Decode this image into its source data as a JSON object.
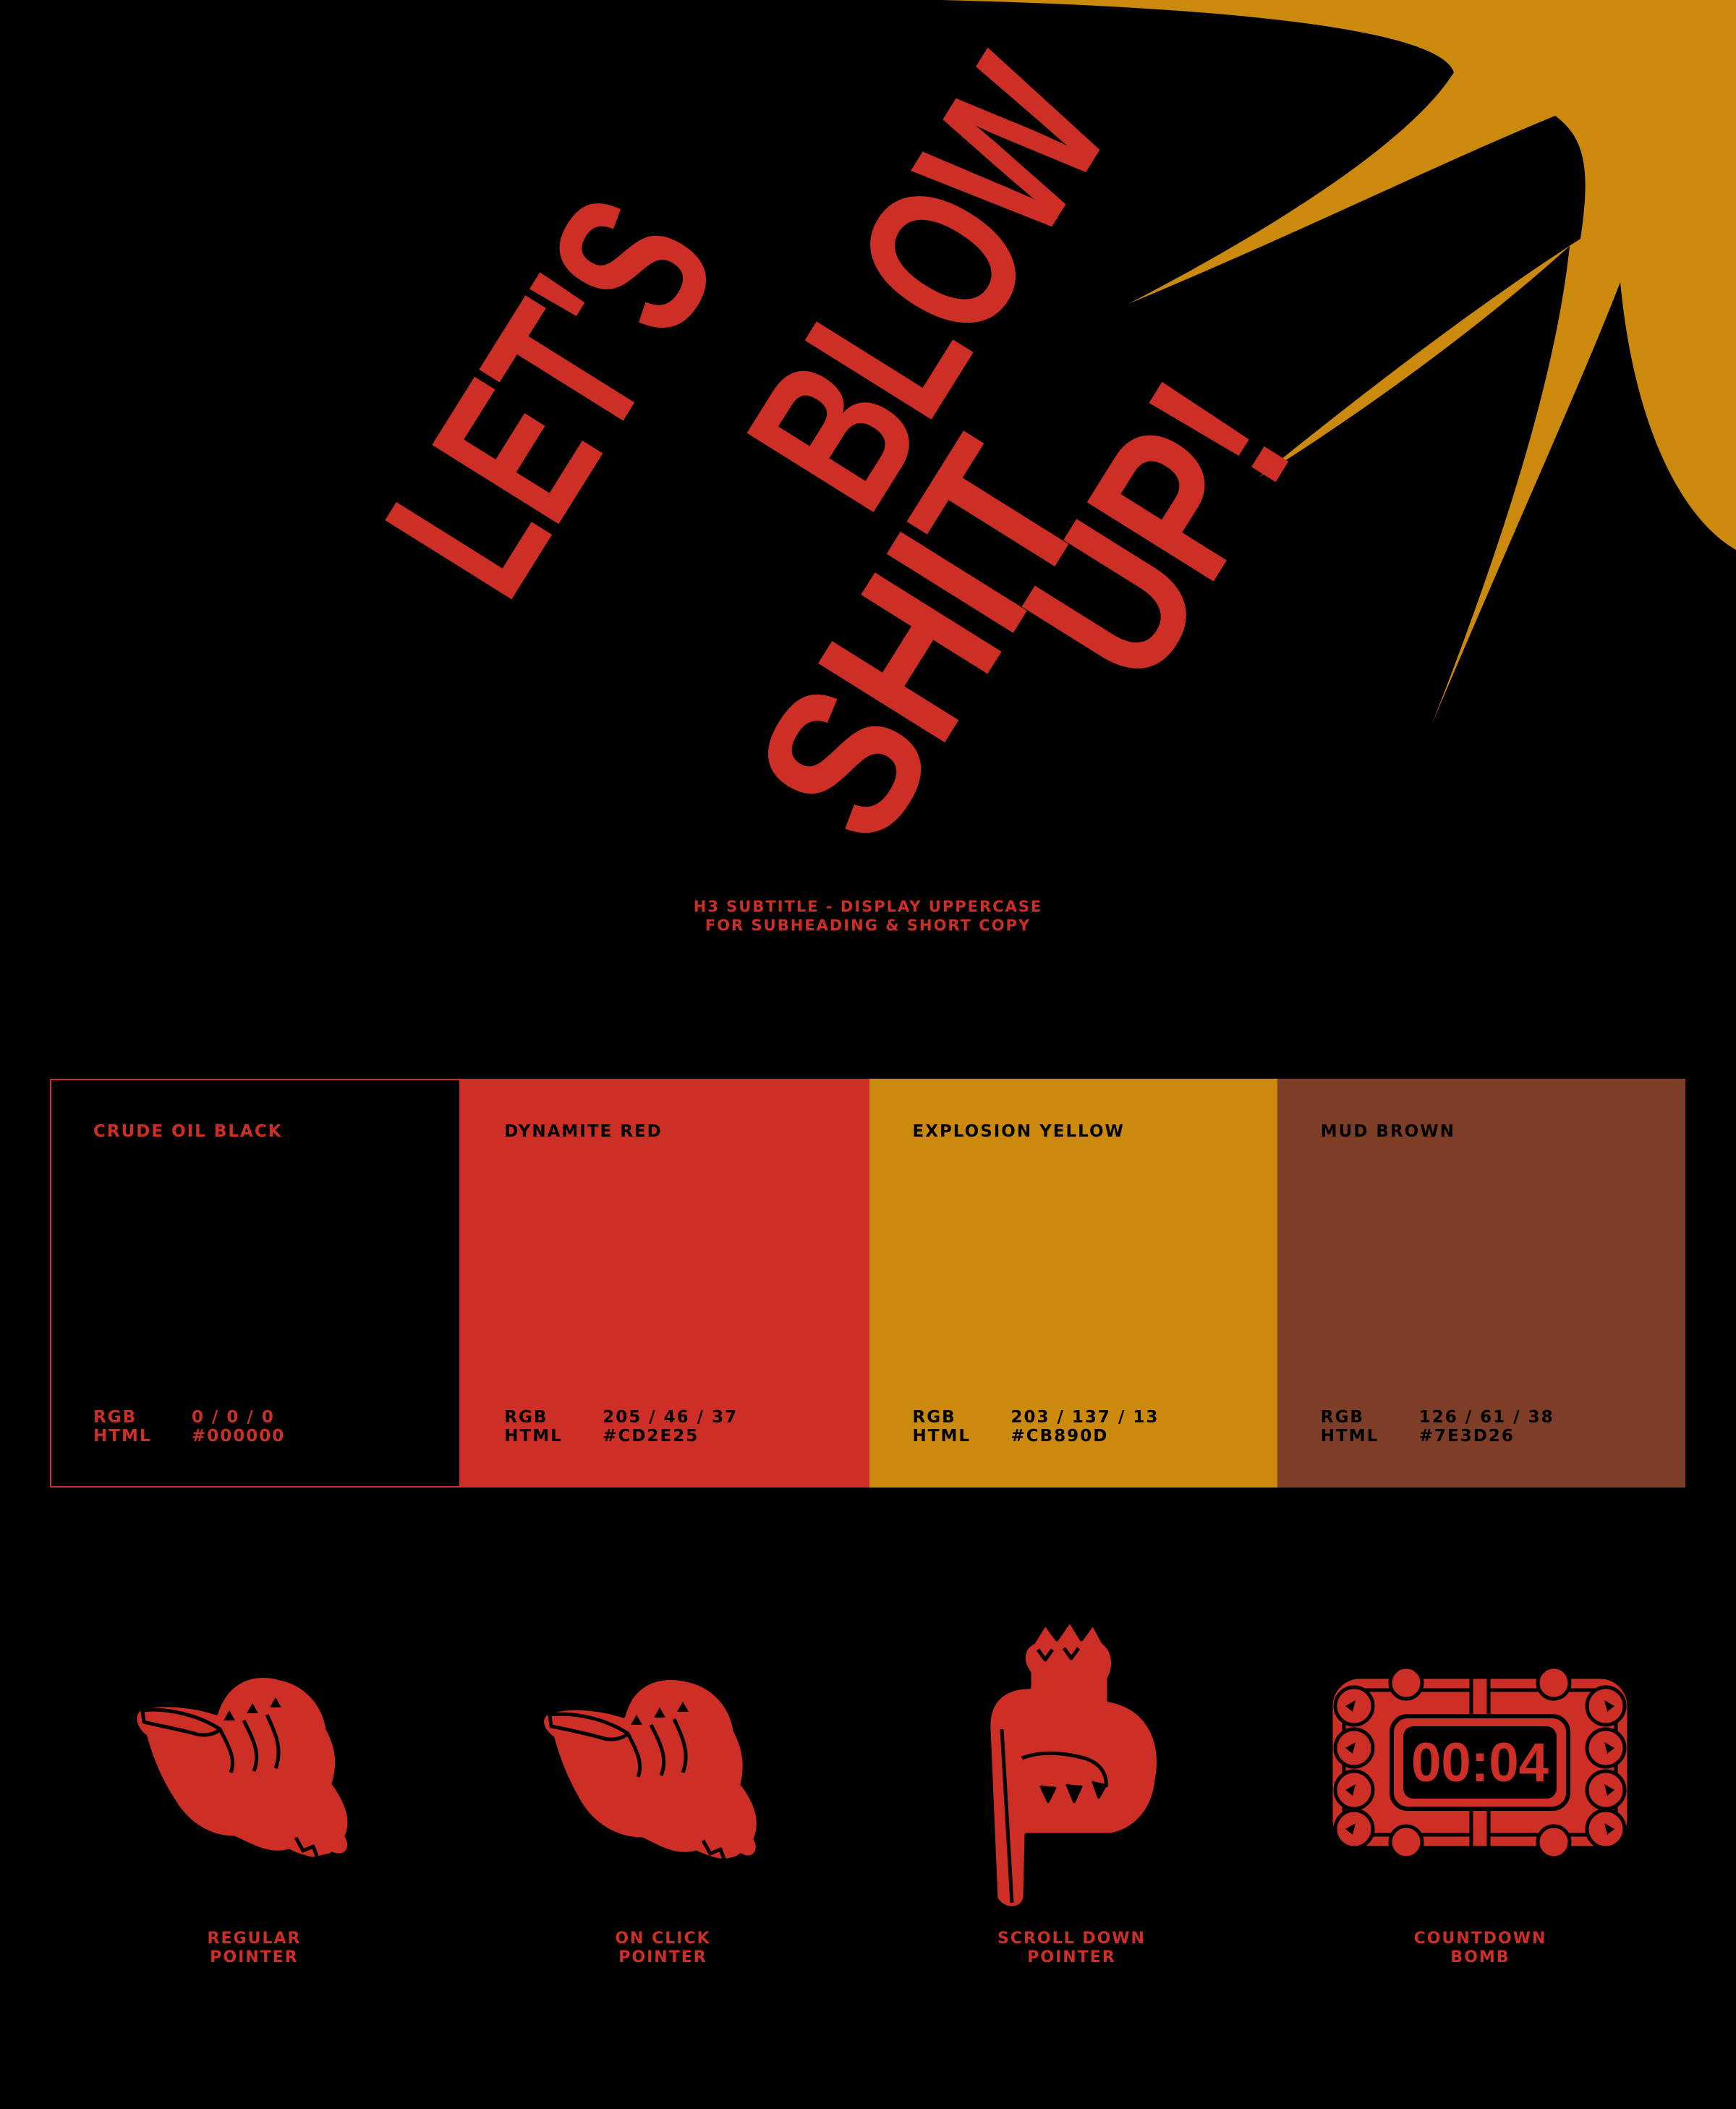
{
  "headline": {
    "line1": "LET'S",
    "line2": "BLOW",
    "line3": "SHIT",
    "line4": "UP!"
  },
  "subtitle": {
    "line1": "H3 SUBTITLE - DISPLAY UPPERCASE",
    "line2": "FOR SUBHEADING & SHORT COPY"
  },
  "palette": [
    {
      "name": "CRUDE OIL BLACK",
      "rgb_label": "RGB",
      "rgb": "0 / 0 / 0",
      "html_label": "HTML",
      "html": "#000000",
      "color": "#000000",
      "text_color": "#CD2E25"
    },
    {
      "name": "DYNAMITE RED",
      "rgb_label": "RGB",
      "rgb": "205 / 46 / 37",
      "html_label": "HTML",
      "html": "#CD2E25",
      "color": "#CD2E25",
      "text_color": "#000000"
    },
    {
      "name": "EXPLOSION YELLOW",
      "rgb_label": "RGB",
      "rgb": "203 / 137 / 13",
      "html_label": "HTML",
      "html": "#CB890D",
      "color": "#CB890D",
      "text_color": "#000000"
    },
    {
      "name": "MUD BROWN",
      "rgb_label": "RGB",
      "rgb": "126 / 61 / 38",
      "html_label": "HTML",
      "html": "#7E3D26",
      "color": "#7E3D26",
      "text_color": "#000000"
    }
  ],
  "cursors": [
    {
      "line1": "REGULAR",
      "line2": "POINTER",
      "icon": "regular-pointer-hand-icon"
    },
    {
      "line1": "ON CLICK",
      "line2": "POINTER",
      "icon": "on-click-pointer-hand-icon"
    },
    {
      "line1": "SCROLL DOWN",
      "line2": "POINTER",
      "icon": "scroll-down-pointer-hand-icon"
    },
    {
      "line1": "COUNTDOWN",
      "line2": "BOMB",
      "icon": "countdown-bomb-icon",
      "timer": "00:04"
    }
  ]
}
